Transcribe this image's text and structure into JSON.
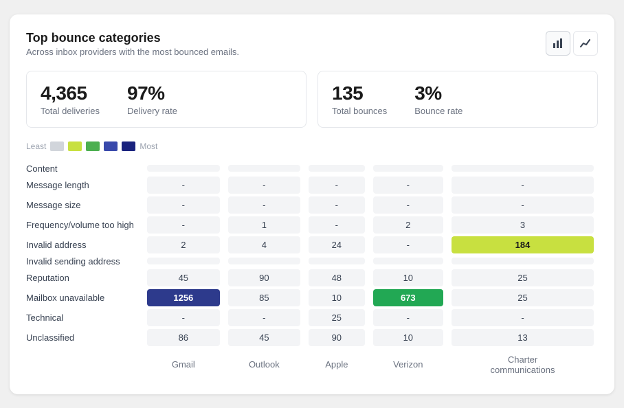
{
  "card": {
    "title": "Top bounce categories",
    "subtitle": "Across inbox providers with the most bounced emails."
  },
  "toggles": [
    {
      "label": "Bar chart",
      "icon": "▦",
      "active": true
    },
    {
      "label": "Line chart",
      "icon": "↗",
      "active": false
    }
  ],
  "stats": [
    {
      "items": [
        {
          "value": "4,365",
          "label": "Total deliveries"
        },
        {
          "value": "97%",
          "label": "Delivery rate"
        }
      ]
    },
    {
      "items": [
        {
          "value": "135",
          "label": "Total bounces"
        },
        {
          "value": "3%",
          "label": "Bounce rate"
        }
      ]
    }
  ],
  "legend": {
    "least_label": "Least",
    "most_label": "Most",
    "swatches": [
      "#d1d5db",
      "#c8e040",
      "#4caf50",
      "#3949ab",
      "#1a237e"
    ]
  },
  "columns": [
    "Gmail",
    "Outlook",
    "Apple",
    "Verizon",
    "Charter\ncommunications"
  ],
  "rows": [
    {
      "label": "Content",
      "cells": [
        {
          "value": "",
          "type": "empty"
        },
        {
          "value": "",
          "type": "empty"
        },
        {
          "value": "",
          "type": "empty"
        },
        {
          "value": "",
          "type": "empty"
        },
        {
          "value": "",
          "type": "empty"
        }
      ]
    },
    {
      "label": "Message length",
      "cells": [
        {
          "value": "-",
          "type": "normal"
        },
        {
          "value": "-",
          "type": "normal"
        },
        {
          "value": "-",
          "type": "normal"
        },
        {
          "value": "-",
          "type": "normal"
        },
        {
          "value": "-",
          "type": "normal"
        }
      ]
    },
    {
      "label": "Message size",
      "cells": [
        {
          "value": "-",
          "type": "normal"
        },
        {
          "value": "-",
          "type": "normal"
        },
        {
          "value": "-",
          "type": "normal"
        },
        {
          "value": "-",
          "type": "normal"
        },
        {
          "value": "-",
          "type": "normal"
        }
      ]
    },
    {
      "label": "Frequency/volume too high",
      "cells": [
        {
          "value": "-",
          "type": "normal"
        },
        {
          "value": "1",
          "type": "normal"
        },
        {
          "value": "-",
          "type": "normal"
        },
        {
          "value": "2",
          "type": "normal"
        },
        {
          "value": "3",
          "type": "normal"
        }
      ]
    },
    {
      "label": "Invalid address",
      "cells": [
        {
          "value": "2",
          "type": "normal"
        },
        {
          "value": "4",
          "type": "normal"
        },
        {
          "value": "24",
          "type": "normal"
        },
        {
          "value": "-",
          "type": "normal"
        },
        {
          "value": "184",
          "type": "highlight-yellow"
        }
      ]
    },
    {
      "label": "Invalid sending address",
      "cells": [
        {
          "value": "",
          "type": "empty"
        },
        {
          "value": "",
          "type": "empty"
        },
        {
          "value": "",
          "type": "empty"
        },
        {
          "value": "",
          "type": "empty"
        },
        {
          "value": "",
          "type": "empty"
        }
      ]
    },
    {
      "label": "Reputation",
      "cells": [
        {
          "value": "45",
          "type": "normal"
        },
        {
          "value": "90",
          "type": "normal"
        },
        {
          "value": "48",
          "type": "normal"
        },
        {
          "value": "10",
          "type": "normal"
        },
        {
          "value": "25",
          "type": "normal"
        }
      ]
    },
    {
      "label": "Mailbox unavailable",
      "cells": [
        {
          "value": "1256",
          "type": "highlight-dark-blue"
        },
        {
          "value": "85",
          "type": "normal"
        },
        {
          "value": "10",
          "type": "normal"
        },
        {
          "value": "673",
          "type": "highlight-green"
        },
        {
          "value": "25",
          "type": "normal"
        }
      ]
    },
    {
      "label": "Technical",
      "cells": [
        {
          "value": "-",
          "type": "normal"
        },
        {
          "value": "-",
          "type": "normal"
        },
        {
          "value": "25",
          "type": "normal"
        },
        {
          "value": "-",
          "type": "normal"
        },
        {
          "value": "-",
          "type": "normal"
        }
      ]
    },
    {
      "label": "Unclassified",
      "cells": [
        {
          "value": "86",
          "type": "normal"
        },
        {
          "value": "45",
          "type": "normal"
        },
        {
          "value": "90",
          "type": "normal"
        },
        {
          "value": "10",
          "type": "normal"
        },
        {
          "value": "13",
          "type": "normal"
        }
      ]
    }
  ]
}
